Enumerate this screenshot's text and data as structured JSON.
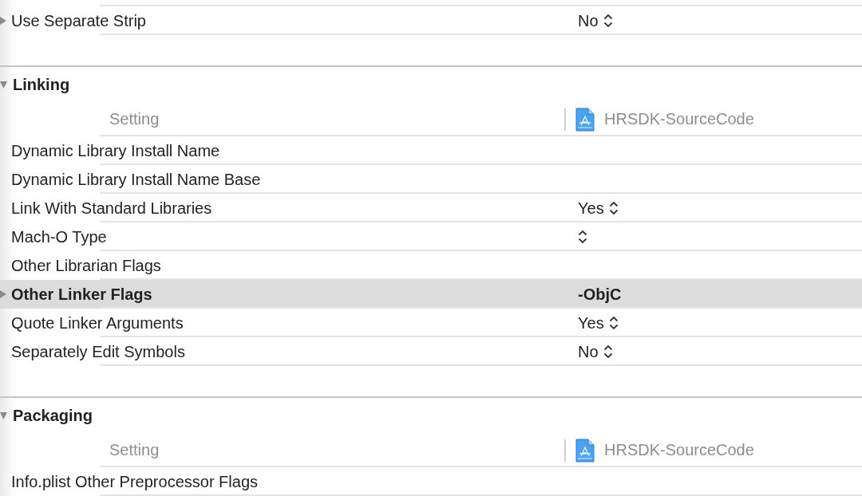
{
  "rows_above": [
    {
      "name": "Use Separate Strip",
      "kind": "popup",
      "value": "No",
      "expandable": true,
      "selected": false
    }
  ],
  "sections": [
    {
      "title": "Linking",
      "expanded": true,
      "column_header": "Setting",
      "target": "HRSDK-SourceCode",
      "rows": [
        {
          "name": "Dynamic Library Install Name",
          "kind": "empty",
          "expandable": false,
          "selected": false
        },
        {
          "name": "Dynamic Library Install Name Base",
          "kind": "empty",
          "expandable": false,
          "selected": false
        },
        {
          "name": "Link With Standard Libraries",
          "kind": "popup",
          "value": "Yes",
          "expandable": false,
          "selected": false
        },
        {
          "name": "Mach-O Type",
          "kind": "popup",
          "expandable": false,
          "selected": false
        },
        {
          "name": "Other Librarian Flags",
          "kind": "empty",
          "expandable": false,
          "selected": false
        },
        {
          "name": "Other Linker Flags",
          "kind": "text",
          "value": "-ObjC",
          "expandable": true,
          "selected": true
        },
        {
          "name": "Quote Linker Arguments",
          "kind": "popup",
          "value": "Yes",
          "expandable": false,
          "selected": false
        },
        {
          "name": "Separately Edit Symbols",
          "kind": "popup",
          "value": "No",
          "expandable": false,
          "selected": false
        }
      ]
    },
    {
      "title": "Packaging",
      "expanded": true,
      "column_header": "Setting",
      "target": "HRSDK-SourceCode",
      "rows": [
        {
          "name": "Info.plist Other Preprocessor Flags",
          "kind": "empty",
          "expandable": false,
          "selected": false
        }
      ]
    }
  ]
}
